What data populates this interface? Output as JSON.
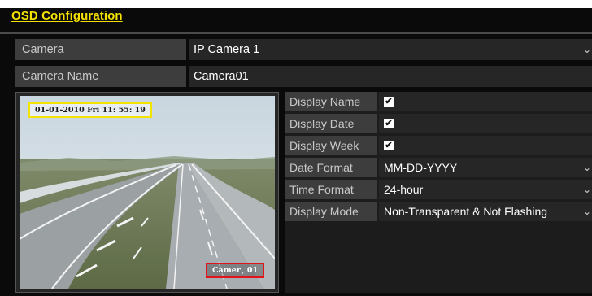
{
  "page": {
    "title": "OSD Configuration"
  },
  "camera": {
    "label": "Camera",
    "value": "IP Camera 1"
  },
  "camera_name": {
    "label": "Camera Name",
    "value": "Camera01"
  },
  "preview": {
    "osd_date_text": "01-01-2010  Fri  11: 55: 19",
    "osd_name_text": "Camer¸ 01"
  },
  "options": {
    "display_name": {
      "label": "Display Name",
      "checked": true
    },
    "display_date": {
      "label": "Display Date",
      "checked": true
    },
    "display_week": {
      "label": "Display Week",
      "checked": true
    },
    "date_format": {
      "label": "Date Format",
      "value": "MM-DD-YYYY"
    },
    "time_format": {
      "label": "Time Format",
      "value": "24-hour"
    },
    "display_mode": {
      "label": "Display Mode",
      "value": "Non-Transparent & Not Flashing"
    }
  },
  "colors": {
    "title": "#f5e100",
    "date_box": "#f2e400",
    "name_box": "#e0141a"
  },
  "icons": {
    "dropdown": "chevron-down-icon",
    "check": "checkbox-checked-icon"
  }
}
